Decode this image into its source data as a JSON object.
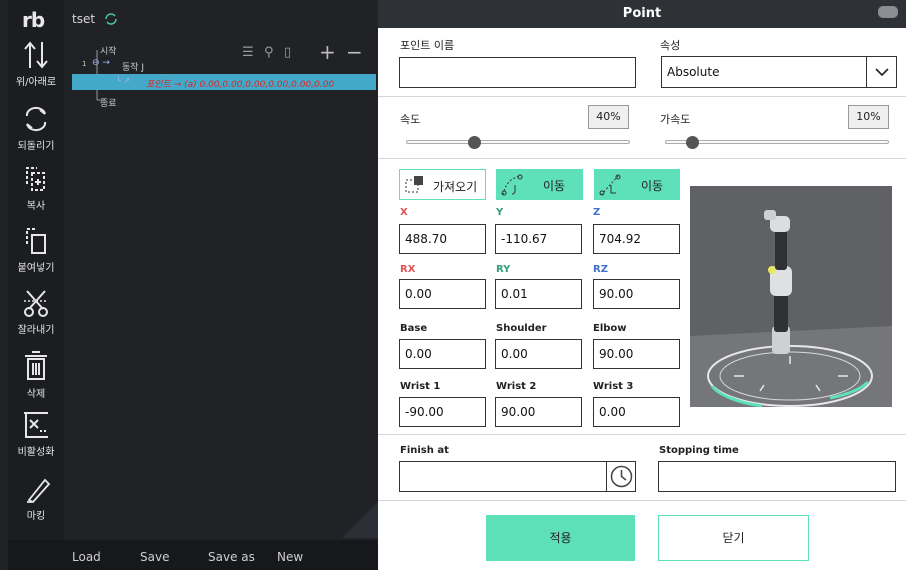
{
  "app": {
    "logo": "rb",
    "project_name": "tset"
  },
  "toolbar": [
    {
      "label": "위/아래로",
      "icon": "up-down-arrows-icon"
    },
    {
      "label": "되돌리기",
      "icon": "undo-redo-icon"
    },
    {
      "label": "복사",
      "icon": "copy-icon"
    },
    {
      "label": "붙여넣기",
      "icon": "paste-icon"
    },
    {
      "label": "잘라내기",
      "icon": "scissors-icon"
    },
    {
      "label": "삭제",
      "icon": "trash-icon"
    },
    {
      "label": "비활성화",
      "icon": "disable-icon"
    },
    {
      "label": "마킹",
      "icon": "marker-icon"
    }
  ],
  "tree": {
    "start": "시작",
    "line_num": "1",
    "move_j": "동작 J",
    "point_row": "포인트 → (a) 0.00,0.00,0.00,0.00,0.00,0.00",
    "end": "종료"
  },
  "bottom": {
    "load": "Load",
    "save": "Save",
    "save_as": "Save as",
    "new": "New"
  },
  "dialog": {
    "title": "Point",
    "name_label": "포인트 이름",
    "name_value": "",
    "attr_label": "속성",
    "attr_value": "Absolute",
    "speed_label": "속도",
    "speed_value": "40%",
    "speed_level": 0.4,
    "accel_label": "가속도",
    "accel_value": "10%",
    "accel_level": 0.1,
    "import_btn": "가져오기",
    "move_btn1": "이동",
    "move_btn2": "이동",
    "fields": {
      "x": {
        "label": "X",
        "value": "488.70"
      },
      "y": {
        "label": "Y",
        "value": "-110.67"
      },
      "z": {
        "label": "Z",
        "value": "704.92"
      },
      "rx": {
        "label": "RX",
        "value": "0.00"
      },
      "ry": {
        "label": "RY",
        "value": "0.01"
      },
      "rz": {
        "label": "RZ",
        "value": "90.00"
      },
      "base": {
        "label": "Base",
        "value": "0.00"
      },
      "shoulder": {
        "label": "Shoulder",
        "value": "0.00"
      },
      "elbow": {
        "label": "Elbow",
        "value": "90.00"
      },
      "wrist1": {
        "label": "Wrist 1",
        "value": "-90.00"
      },
      "wrist2": {
        "label": "Wrist 2",
        "value": "90.00"
      },
      "wrist3": {
        "label": "Wrist 3",
        "value": "0.00"
      }
    },
    "finish_label": "Finish at",
    "finish_value": "",
    "stop_label": "Stopping time",
    "stop_value": "",
    "apply": "적용",
    "close": "닫기"
  },
  "colors": {
    "accent": "#5ee0b9",
    "x": "#e15454",
    "y": "#34a17c",
    "z": "#3e72cf",
    "selection": "#44a8c9",
    "error_text": "#d42a2a"
  }
}
